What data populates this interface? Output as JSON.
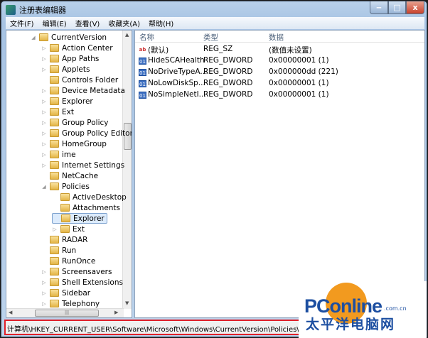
{
  "window": {
    "title": "注册表编辑器",
    "minimize": "‒",
    "maximize": "□",
    "close": "x"
  },
  "menu": [
    "文件(F)",
    "编辑(E)",
    "查看(V)",
    "收藏夹(A)",
    "帮助(H)"
  ],
  "tree": [
    {
      "label": "CurrentVersion",
      "level": 0,
      "expander": "◢"
    },
    {
      "label": "Action Center",
      "level": 1,
      "expander": "▷"
    },
    {
      "label": "App Paths",
      "level": 1,
      "expander": "▷"
    },
    {
      "label": "Applets",
      "level": 1,
      "expander": "▷"
    },
    {
      "label": "Controls Folder",
      "level": 1,
      "expander": ""
    },
    {
      "label": "Device Metadata",
      "level": 1,
      "expander": "▷"
    },
    {
      "label": "Explorer",
      "level": 1,
      "expander": "▷"
    },
    {
      "label": "Ext",
      "level": 1,
      "expander": "▷"
    },
    {
      "label": "Group Policy",
      "level": 1,
      "expander": "▷"
    },
    {
      "label": "Group Policy Editor",
      "level": 1,
      "expander": "▷"
    },
    {
      "label": "HomeGroup",
      "level": 1,
      "expander": "▷"
    },
    {
      "label": "ime",
      "level": 1,
      "expander": "▷"
    },
    {
      "label": "Internet Settings",
      "level": 1,
      "expander": "▷"
    },
    {
      "label": "NetCache",
      "level": 1,
      "expander": ""
    },
    {
      "label": "Policies",
      "level": 1,
      "expander": "◢"
    },
    {
      "label": "ActiveDesktop",
      "level": 2,
      "expander": ""
    },
    {
      "label": "Attachments",
      "level": 2,
      "expander": ""
    },
    {
      "label": "Explorer",
      "level": 2,
      "expander": "",
      "selected": true
    },
    {
      "label": "Ext",
      "level": 2,
      "expander": "▷"
    },
    {
      "label": "RADAR",
      "level": 1,
      "expander": ""
    },
    {
      "label": "Run",
      "level": 1,
      "expander": ""
    },
    {
      "label": "RunOnce",
      "level": 1,
      "expander": ""
    },
    {
      "label": "Screensavers",
      "level": 1,
      "expander": "▷"
    },
    {
      "label": "Shell Extensions",
      "level": 1,
      "expander": "▷"
    },
    {
      "label": "Sidebar",
      "level": 1,
      "expander": "▷"
    },
    {
      "label": "Telephony",
      "level": 1,
      "expander": "▷"
    }
  ],
  "list": {
    "headers": {
      "name": "名称",
      "type": "类型",
      "data": "数据"
    },
    "rows": [
      {
        "icon": "ab",
        "name": "(默认)",
        "type": "REG_SZ",
        "data": "(数值未设置)"
      },
      {
        "icon": "dw",
        "name": "HideSCAHealth",
        "type": "REG_DWORD",
        "data": "0x00000001 (1)"
      },
      {
        "icon": "dw",
        "name": "NoDriveTypeA...",
        "type": "REG_DWORD",
        "data": "0x000000dd (221)"
      },
      {
        "icon": "dw",
        "name": "NoLowDiskSp...",
        "type": "REG_DWORD",
        "data": "0x00000001 (1)"
      },
      {
        "icon": "dw",
        "name": "NoSimpleNetI...",
        "type": "REG_DWORD",
        "data": "0x00000001 (1)"
      }
    ]
  },
  "status": "计算机\\HKEY_CURRENT_USER\\Software\\Microsoft\\Windows\\CurrentVersion\\Policies\\Explo",
  "watermark": {
    "brand": "PConline",
    "domain": ".com.cn",
    "cn": "太平洋电脑网"
  }
}
